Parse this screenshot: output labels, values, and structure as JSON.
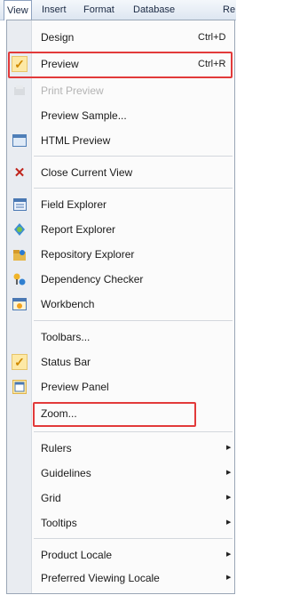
{
  "menubar": {
    "items": [
      "View",
      "Insert",
      "Format",
      "Database",
      "Re"
    ]
  },
  "menu": {
    "items": [
      {
        "label": "Design",
        "shortcut": "Ctrl+D"
      },
      {
        "label": "Preview",
        "shortcut": "Ctrl+R",
        "checked": true
      },
      {
        "label": "Print Preview",
        "disabled": true
      },
      {
        "label": "Preview Sample..."
      },
      {
        "label": "HTML Preview"
      },
      {
        "label": "Close Current View"
      },
      {
        "label": "Field Explorer"
      },
      {
        "label": "Report Explorer"
      },
      {
        "label": "Repository Explorer"
      },
      {
        "label": "Dependency Checker"
      },
      {
        "label": "Workbench"
      },
      {
        "label": "Toolbars..."
      },
      {
        "label": "Status Bar",
        "checked": true
      },
      {
        "label": "Preview Panel"
      },
      {
        "label": "Zoom..."
      },
      {
        "label": "Rulers",
        "submenu": true
      },
      {
        "label": "Guidelines",
        "submenu": true
      },
      {
        "label": "Grid",
        "submenu": true
      },
      {
        "label": "Tooltips",
        "submenu": true
      },
      {
        "label": "Product Locale",
        "submenu": true
      },
      {
        "label": "Preferred Viewing Locale",
        "submenu": true
      }
    ]
  },
  "colors": {
    "highlight_border": "#e23a3a",
    "checkmark": "#d08a00",
    "close_x": "#c0241c"
  }
}
